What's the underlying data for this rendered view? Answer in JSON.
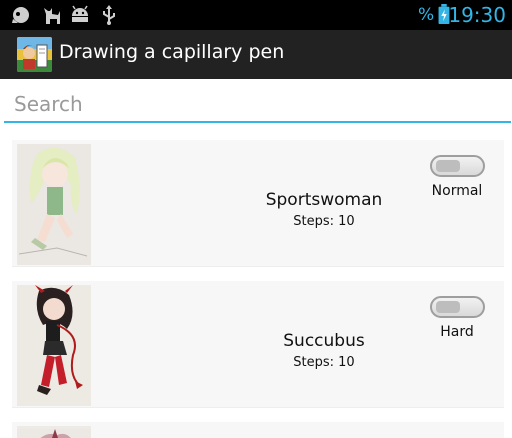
{
  "status_bar": {
    "time": "19:30",
    "battery_text": "%",
    "icons": [
      "notification-icon",
      "cat-icon",
      "android-icon",
      "usb-icon",
      "battery-icon"
    ]
  },
  "action_bar": {
    "title": "Drawing a capillary pen",
    "icon": "app-icon"
  },
  "search": {
    "placeholder": "Search",
    "value": ""
  },
  "items": [
    {
      "title": "Sportswoman",
      "steps": "Steps: 10",
      "difficulty": "Normal",
      "toggle_on": false
    },
    {
      "title": "Succubus",
      "steps": "Steps: 10",
      "difficulty": "Hard",
      "toggle_on": false
    }
  ],
  "colors": {
    "accent": "#33b5e5",
    "status_bar": "#000000",
    "action_bar": "#222222",
    "item_background": "#f7f7f7"
  }
}
